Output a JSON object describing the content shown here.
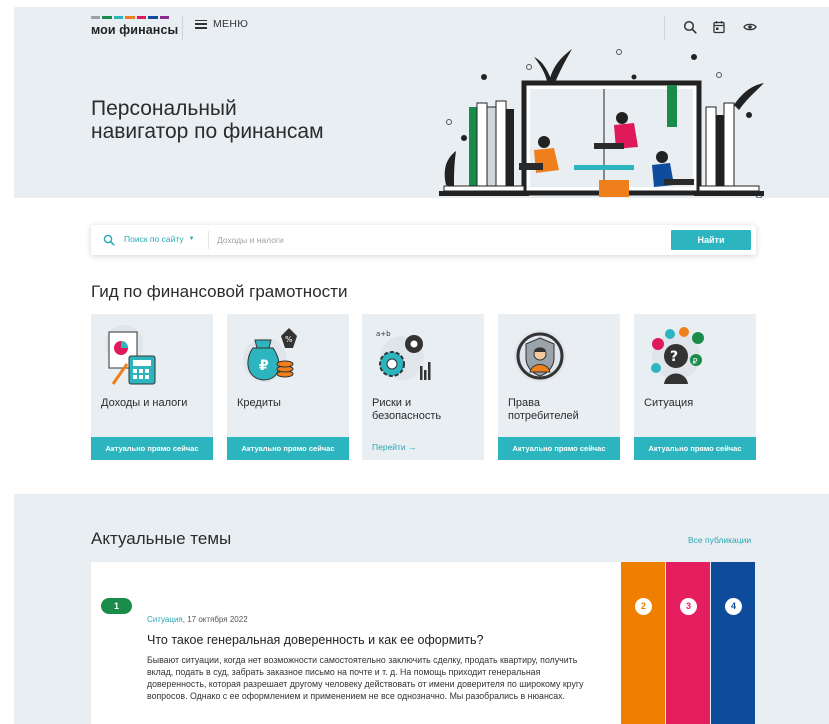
{
  "header": {
    "logo_text": "мои финансы",
    "logo_colors": [
      "#9aa3a9",
      "#1a8c4a",
      "#2cb5bf",
      "#ef7f1a",
      "#e0195a",
      "#0f4c9c",
      "#8a2b8f"
    ],
    "menu_label": "МЕНЮ",
    "icons": [
      "search-icon",
      "calendar-icon",
      "eye-icon"
    ]
  },
  "hero": {
    "title_line1": "Персональный",
    "title_line2": "навигатор по финансам"
  },
  "search": {
    "scope_label": "Поиск по сайту",
    "placeholder": "Доходы и налоги",
    "button_label": "Найти"
  },
  "guide": {
    "title": "Гид по финансовой грамотности",
    "cards": [
      {
        "label": "Доходы и налоги",
        "action": "Актуально прямо сейчас",
        "icon": "income-tax-icon"
      },
      {
        "label": "Кредиты",
        "action": "Актуально прямо сейчас",
        "icon": "money-bag-icon"
      },
      {
        "label": "Риски и безопасность",
        "action": "Перейти",
        "action_arrow": "→",
        "icon": "gears-icon"
      },
      {
        "label": "Права потребителей",
        "action": "Актуально прямо сейчас",
        "icon": "shield-person-icon"
      },
      {
        "label": "Ситуация",
        "action": "Актуально прямо сейчас",
        "icon": "question-person-icon"
      }
    ]
  },
  "topics": {
    "title": "Актуальные темы",
    "all_link": "Все публикации",
    "featured": {
      "number": "1",
      "category": "Ситуация",
      "date": ", 17 октября 2022",
      "title": "Что такое генеральная доверенность и как ее оформить?",
      "body": "Бывают ситуации, когда нет возможности самостоятельно заключить сделку, продать квартиру, получить вклад, подать в суд, забрать заказное письмо на почте и т. д. На помощь приходит генеральная доверенность, которая разрешает другому человеку действовать от имени доверителя по широкому кругу вопросов. Однако с ее оформлением и применением не все однозначно. Мы разобрались в нюансах."
    },
    "tabs": [
      {
        "number": "2",
        "color": "#ef7f00"
      },
      {
        "number": "3",
        "color": "#e51f5f"
      },
      {
        "number": "4",
        "color": "#0e4b9b"
      }
    ]
  },
  "colors": {
    "accent": "#2cb5bf",
    "panel_bg": "#e9eef2",
    "badge_green": "#1a8c4a"
  }
}
